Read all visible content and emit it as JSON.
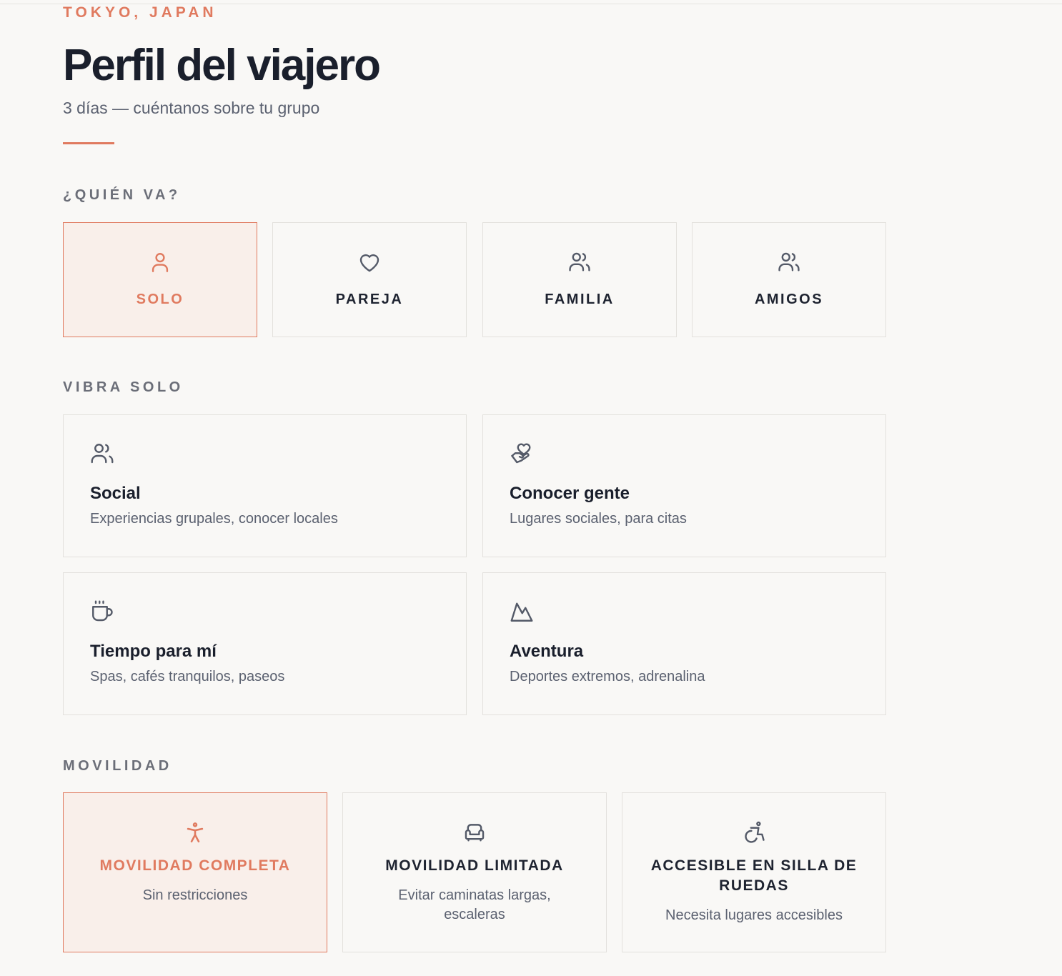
{
  "header": {
    "location": "TOKYO, JAPAN",
    "title": "Perfil del viajero",
    "subtitle": "3 días — cuéntanos sobre tu grupo"
  },
  "colors": {
    "accent": "#e07a5f",
    "selected_bg": "#f9efea",
    "text_dark": "#1a1f2c",
    "text_muted": "#5b6170",
    "background": "#f9f8f6"
  },
  "who": {
    "label": "¿QUIÉN VA?",
    "selected": "solo",
    "options": [
      {
        "id": "solo",
        "label": "SOLO",
        "icon": "user-icon"
      },
      {
        "id": "pareja",
        "label": "PAREJA",
        "icon": "heart-icon"
      },
      {
        "id": "familia",
        "label": "FAMILIA",
        "icon": "users-icon"
      },
      {
        "id": "amigos",
        "label": "AMIGOS",
        "icon": "users-icon"
      }
    ]
  },
  "vibe": {
    "label": "VIBRA SOLO",
    "options": [
      {
        "title": "Social",
        "description": "Experiencias grupales, conocer locales",
        "icon": "users-icon"
      },
      {
        "title": "Conocer gente",
        "description": "Lugares sociales, para citas",
        "icon": "heart-handshake-icon"
      },
      {
        "title": "Tiempo para mí",
        "description": "Spas, cafés tranquilos, paseos",
        "icon": "coffee-icon"
      },
      {
        "title": "Aventura",
        "description": "Deportes extremos, adrenalina",
        "icon": "mountain-icon"
      }
    ]
  },
  "mobility": {
    "label": "MOVILIDAD",
    "selected": "completa",
    "options": [
      {
        "id": "completa",
        "title": "MOVILIDAD COMPLETA",
        "description": "Sin restricciones",
        "icon": "accessibility-person-icon"
      },
      {
        "id": "limitada",
        "title": "MOVILIDAD LIMITADA",
        "description": "Evitar caminatas largas, escaleras",
        "icon": "armchair-icon"
      },
      {
        "id": "silla",
        "title": "ACCESIBLE EN SILLA DE RUEDAS",
        "description": "Necesita lugares accesibles",
        "icon": "wheelchair-icon"
      }
    ]
  }
}
